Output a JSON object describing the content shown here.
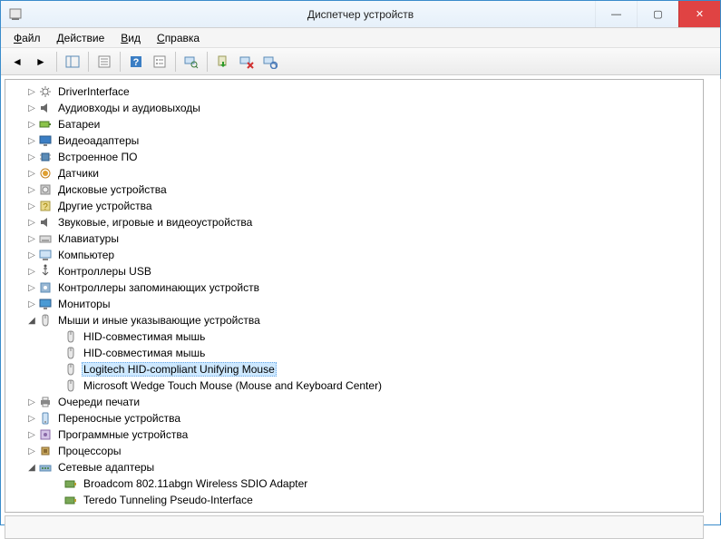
{
  "window": {
    "title": "Диспетчер устройств"
  },
  "menu": {
    "file": "Файл",
    "action": "Действие",
    "view": "Вид",
    "help": "Справка"
  },
  "tree": {
    "items": [
      {
        "exp": "▷",
        "label": "DriverInterface",
        "depth": 1,
        "icon": "gear"
      },
      {
        "exp": "▷",
        "label": "Аудиовходы и аудиовыходы",
        "depth": 1,
        "icon": "audio"
      },
      {
        "exp": "▷",
        "label": "Батареи",
        "depth": 1,
        "icon": "battery"
      },
      {
        "exp": "▷",
        "label": "Видеоадаптеры",
        "depth": 1,
        "icon": "display"
      },
      {
        "exp": "▷",
        "label": "Встроенное ПО",
        "depth": 1,
        "icon": "chip"
      },
      {
        "exp": "▷",
        "label": "Датчики",
        "depth": 1,
        "icon": "sensor"
      },
      {
        "exp": "▷",
        "label": "Дисковые устройства",
        "depth": 1,
        "icon": "disk"
      },
      {
        "exp": "▷",
        "label": "Другие устройства",
        "depth": 1,
        "icon": "other"
      },
      {
        "exp": "▷",
        "label": "Звуковые, игровые и видеоустройства",
        "depth": 1,
        "icon": "audio"
      },
      {
        "exp": "▷",
        "label": "Клавиатуры",
        "depth": 1,
        "icon": "keyboard"
      },
      {
        "exp": "▷",
        "label": "Компьютер",
        "depth": 1,
        "icon": "computer"
      },
      {
        "exp": "▷",
        "label": "Контроллеры USB",
        "depth": 1,
        "icon": "usb"
      },
      {
        "exp": "▷",
        "label": "Контроллеры запоминающих устройств",
        "depth": 1,
        "icon": "storage"
      },
      {
        "exp": "▷",
        "label": "Мониторы",
        "depth": 1,
        "icon": "monitor"
      },
      {
        "exp": "◢",
        "label": "Мыши и иные указывающие устройства",
        "depth": 1,
        "icon": "mouse"
      },
      {
        "exp": "",
        "label": "HID-совместимая мышь",
        "depth": 2,
        "icon": "mouse"
      },
      {
        "exp": "",
        "label": "HID-совместимая мышь",
        "depth": 2,
        "icon": "mouse"
      },
      {
        "exp": "",
        "label": "Logitech HID-compliant Unifying Mouse",
        "depth": 2,
        "icon": "mouse",
        "selected": true
      },
      {
        "exp": "",
        "label": "Microsoft Wedge Touch Mouse (Mouse and Keyboard Center)",
        "depth": 2,
        "icon": "mouse"
      },
      {
        "exp": "▷",
        "label": "Очереди печати",
        "depth": 1,
        "icon": "printer"
      },
      {
        "exp": "▷",
        "label": "Переносные устройства",
        "depth": 1,
        "icon": "portable"
      },
      {
        "exp": "▷",
        "label": "Программные устройства",
        "depth": 1,
        "icon": "software"
      },
      {
        "exp": "▷",
        "label": "Процессоры",
        "depth": 1,
        "icon": "cpu"
      },
      {
        "exp": "◢",
        "label": "Сетевые адаптеры",
        "depth": 1,
        "icon": "network"
      },
      {
        "exp": "",
        "label": "Broadcom 802.11abgn Wireless SDIO Adapter",
        "depth": 2,
        "icon": "netcard"
      },
      {
        "exp": "",
        "label": "Teredo Tunneling Pseudo-Interface",
        "depth": 2,
        "icon": "netcard"
      }
    ]
  }
}
